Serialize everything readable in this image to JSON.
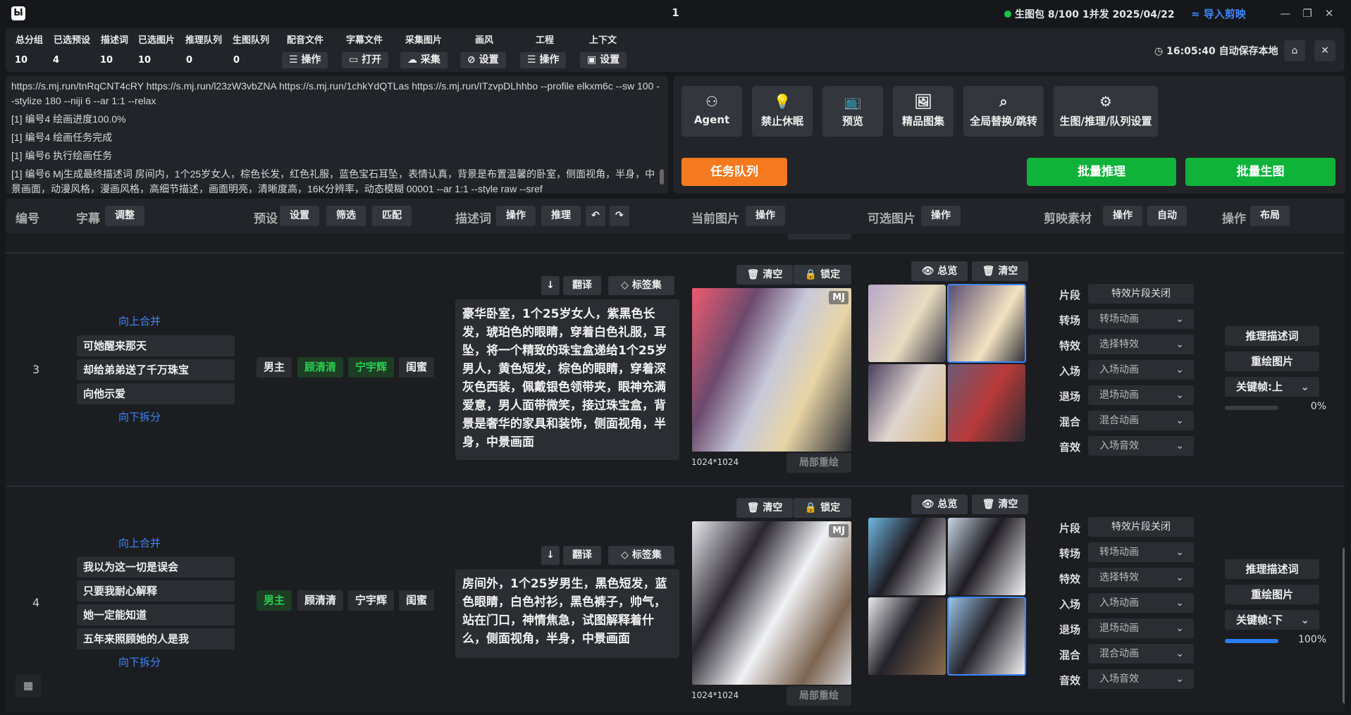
{
  "titlebar": {
    "logo": "logo-icon",
    "window_number": "1",
    "pack_status": "生图包 8/100 1并发 2025/04/22",
    "import_label": "导入剪映",
    "status_color": "#19c24a"
  },
  "stats": {
    "labels": [
      "总分组",
      "已选预设",
      "描述词",
      "已选图片",
      "推理队列",
      "生图队列",
      "配音文件",
      "字幕文件",
      "采集图片",
      "画风",
      "工程",
      "上下文"
    ],
    "values": [
      "10",
      "4",
      "10",
      "10",
      "0",
      "0"
    ],
    "buttons": [
      "操作",
      "打开",
      "采集",
      "设置",
      "操作",
      "设置"
    ],
    "autosave": "16:05:40 自动保存本地"
  },
  "log": {
    "lines": [
      "https://s.mj.run/tnRqCNT4cRY https://s.mj.run/l23zW3vbZNA https://s.mj.run/1chkYdQTLas https://s.mj.run/ITzvpDLhhbo --profile elkxm6c --sw 100 --stylize 180 --niji 6 --ar 1:1 --relax",
      "[1] 编号4 绘画进度100.0%",
      "[1] 编号4 绘画任务完成",
      "[1] 编号6 执行绘画任务",
      "[1] 编号6 Mj生成最终描述词 房间内，1个25岁女人，棕色长发，红色礼服，蓝色宝石耳坠，表情认真，背景是布置温馨的卧室，侧面视角，半身，中景画面，动漫风格，漫画风格，高细节描述，画面明亮，清晰度高，16K分辨率，动态模糊 00001 --ar 1:1 --style raw --sref"
    ]
  },
  "tools": {
    "items": [
      {
        "label": "Agent",
        "icon": "agent-icon"
      },
      {
        "label": "禁止休眠",
        "icon": "bulb-icon"
      },
      {
        "label": "预览",
        "icon": "tv-icon"
      },
      {
        "label": "精品图集",
        "icon": "image-icon"
      },
      {
        "label": "全局替换/跳转",
        "icon": "search-list-icon"
      },
      {
        "label": "生图/推理/队列设置",
        "icon": "gear-icon"
      }
    ],
    "task_queue": "任务队列",
    "batch_infer": "批量推理",
    "batch_gen": "批量生图",
    "colors": {
      "orange": "#f57a1f",
      "green": "#0fb33a"
    }
  },
  "header": {
    "num": "编号",
    "subtitle": "字幕",
    "adjust": "调整",
    "preset": "预设",
    "set": "设置",
    "filter": "筛选",
    "match": "匹配",
    "desc": "描述词",
    "operate": "操作",
    "infer": "推理",
    "current_image": "当前图片",
    "optional_image": "可选图片",
    "jianying": "剪映素材",
    "auto": "自动",
    "ops": "操作",
    "layout": "布局"
  },
  "common": {
    "merge_up": "向上合并",
    "split_down": "向下拆分",
    "translate": "翻译",
    "tag_set": "标签集",
    "clear": "清空",
    "lock": "锁定",
    "overview": "总览",
    "mj": "MJ",
    "resolution": "1024*1024",
    "partial_redraw": "局部重绘",
    "fx_labels": [
      "片段",
      "转场",
      "特效",
      "入场",
      "退场",
      "混合",
      "音效"
    ],
    "fx_values": [
      "特效片段关闭",
      "转场动画",
      "选择特效",
      "入场动画",
      "退场动画",
      "混合动画",
      "入场音效"
    ],
    "infer_desc": "推理描述词",
    "redraw_image": "重绘图片"
  },
  "rows": [
    {
      "num": "3",
      "subtitles": [
        "可她醒来那天",
        "却给弟弟送了千万珠宝",
        "向他示爱"
      ],
      "roles": [
        "男主",
        "顾清清",
        "宁宇辉",
        "闺蜜"
      ],
      "active_roles": [
        1,
        2
      ],
      "description": "豪华卧室，1个25岁女人，紫黑色长发，琥珀色的眼睛，穿着白色礼服，耳坠，将一个精致的珠宝盒递给1个25岁男人，黄色短发，棕色的眼睛，穿着深灰色西装，佩戴银色领带夹，眼神充满爱意，男人面带微笑，接过珠宝盒，背景是奢华的家具和装饰，侧面视角，半身，中景画面",
      "keyframe": "关键帧:上",
      "progress": 0,
      "progress_label": "0%",
      "selected_thumb": 1
    },
    {
      "num": "4",
      "subtitles": [
        "我以为这一切是误会",
        "只要我耐心解释",
        "她一定能知道",
        "五年来照顾她的人是我"
      ],
      "roles": [
        "男主",
        "顾清清",
        "宁宇辉",
        "闺蜜"
      ],
      "active_roles": [
        0
      ],
      "description": "房间外，1个25岁男生，黑色短发，蓝色眼睛，白色衬衫，黑色裤子，帅气，站在门口，神情焦急，试图解释着什么，侧面视角，半身，中景画面",
      "keyframe": "关键帧:下",
      "progress": 100,
      "progress_label": "100%",
      "selected_thumb": 3
    }
  ]
}
